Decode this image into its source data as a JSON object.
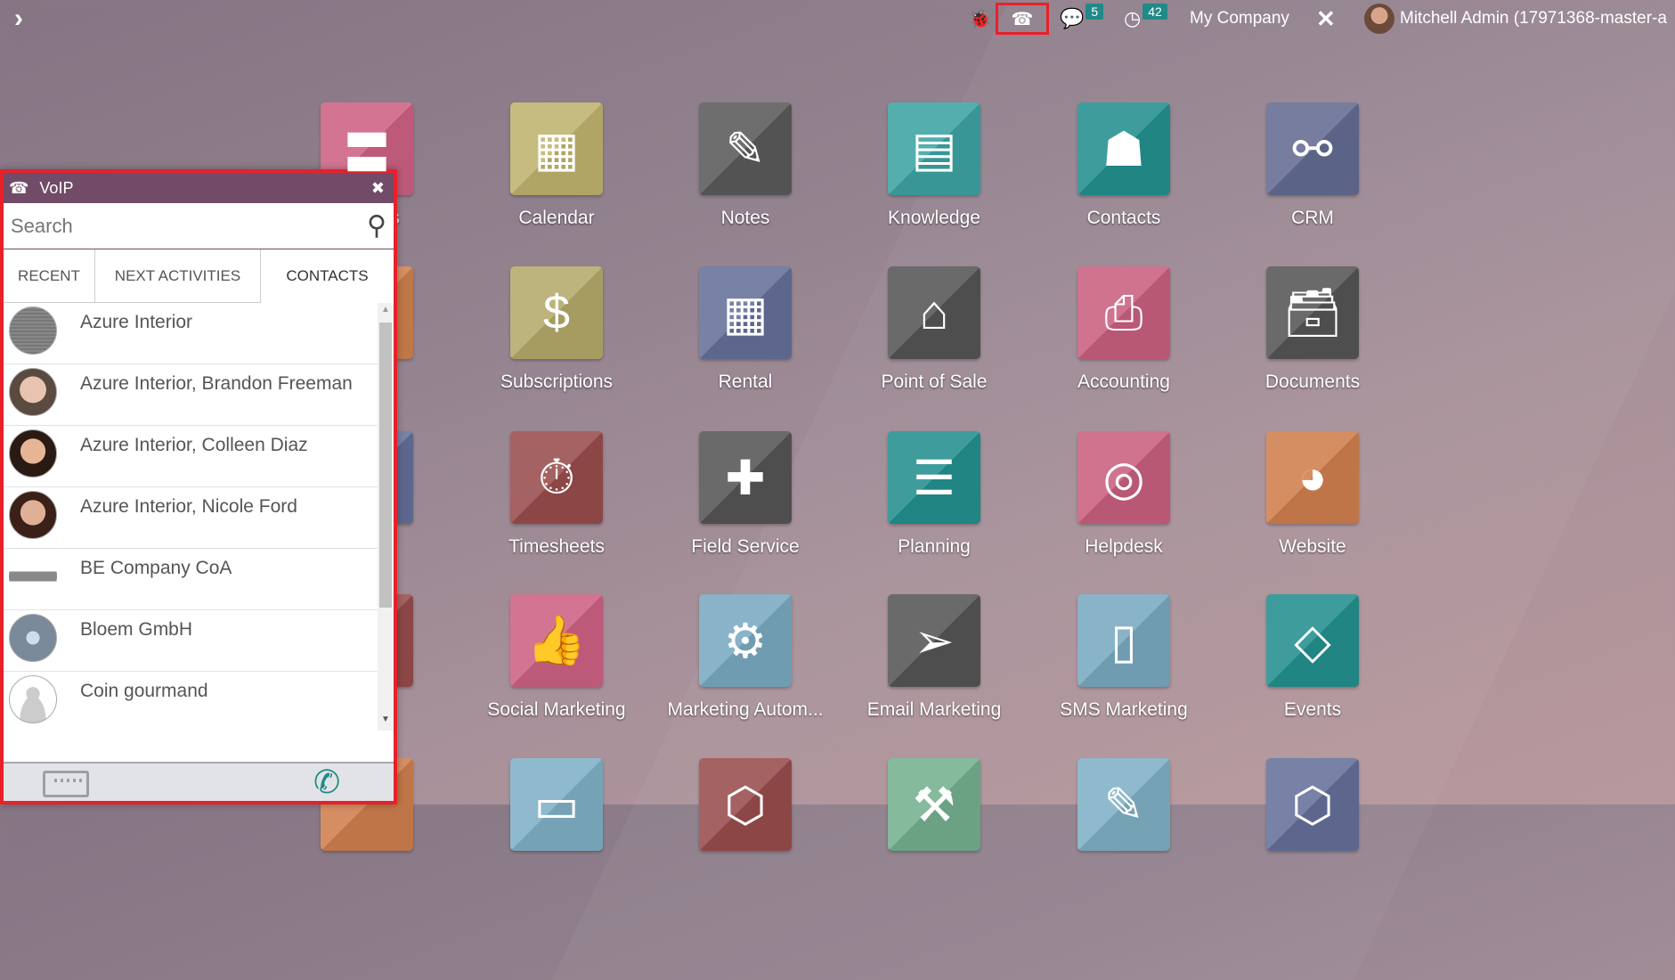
{
  "topbar": {
    "menu_toggle": "›",
    "bug_icon": "bug-icon",
    "voip_icon": "phone-keypad-icon",
    "messages_count": "5",
    "activities_count": "42",
    "company": "My Company",
    "user": "Mitchell Admin (17971368-master-a"
  },
  "apps": [
    {
      "label": "Discuss",
      "color": "#cd6283",
      "icon": "〓"
    },
    {
      "label": "Calendar",
      "color": "#bfb36d",
      "icon": "▦"
    },
    {
      "label": "Notes",
      "color": "#5a5a5a",
      "icon": "✎"
    },
    {
      "label": "Knowledge",
      "color": "#3ea3a3",
      "icon": "▤"
    },
    {
      "label": "Contacts",
      "color": "#23908e",
      "icon": "☗"
    },
    {
      "label": "CRM",
      "color": "#636b91",
      "icon": "⚯"
    },
    {
      "label": "",
      "color": "#d0814e",
      "icon": ""
    },
    {
      "label": "Subscriptions",
      "color": "#b4a96a",
      "icon": "$"
    },
    {
      "label": "Rental",
      "color": "#65709a",
      "icon": "▦"
    },
    {
      "label": "Point of Sale",
      "color": "#555",
      "icon": "⌂"
    },
    {
      "label": "Accounting",
      "color": "#c9607f",
      "icon": "⎙"
    },
    {
      "label": "Documents",
      "color": "#555",
      "icon": "🗃"
    },
    {
      "label": "",
      "color": "#65709a",
      "icon": ""
    },
    {
      "label": "Timesheets",
      "color": "#994c4c",
      "icon": "⏱"
    },
    {
      "label": "Field Service",
      "color": "#555",
      "icon": "✚"
    },
    {
      "label": "Planning",
      "color": "#23908e",
      "icon": "☰"
    },
    {
      "label": "Helpdesk",
      "color": "#c9607f",
      "icon": "◎"
    },
    {
      "label": "Website",
      "color": "#cf7f4d",
      "icon": "◕"
    },
    {
      "label": "",
      "color": "#994c4c",
      "icon": ""
    },
    {
      "label": "Social Marketing",
      "color": "#cd6283",
      "icon": "👍"
    },
    {
      "label": "Marketing Autom...",
      "color": "#79a9c0",
      "icon": "⚙"
    },
    {
      "label": "Email Marketing",
      "color": "#555",
      "icon": "➢"
    },
    {
      "label": "SMS Marketing",
      "color": "#79a9c0",
      "icon": "▯"
    },
    {
      "label": "Events",
      "color": "#23908e",
      "icon": "◇"
    },
    {
      "label": "",
      "color": "#cf7f4d",
      "icon": ""
    },
    {
      "label": "",
      "color": "#80b0c6",
      "icon": "▭"
    },
    {
      "label": "",
      "color": "#994c4c",
      "icon": "⬡"
    },
    {
      "label": "",
      "color": "#74b08e",
      "icon": "⚒"
    },
    {
      "label": "",
      "color": "#80b0c6",
      "icon": "✎"
    },
    {
      "label": "",
      "color": "#65709a",
      "icon": "⬡"
    }
  ],
  "voip": {
    "title": "VoIP",
    "close": "✖",
    "search_placeholder": "Search",
    "tabs": [
      {
        "label": "RECENT"
      },
      {
        "label": "NEXT ACTIVITIES"
      },
      {
        "label": "CONTACTS",
        "active": true
      }
    ],
    "contacts": [
      {
        "name": "Azure Interior",
        "avatar": "azure logo"
      },
      {
        "name": "Azure Interior, Brandon Freeman",
        "avatar": "photo"
      },
      {
        "name": "Azure Interior, Colleen Diaz",
        "avatar": "photo"
      },
      {
        "name": "Azure Interior, Nicole Ford",
        "avatar": "photo"
      },
      {
        "name": "BE Company CoA",
        "avatar": "logo"
      },
      {
        "name": "Bloem GmbH",
        "avatar": "logo"
      },
      {
        "name": "Coin gourmand",
        "avatar": "placeholder"
      }
    ],
    "accent": "#714b67",
    "call_color": "#1f8a87"
  }
}
